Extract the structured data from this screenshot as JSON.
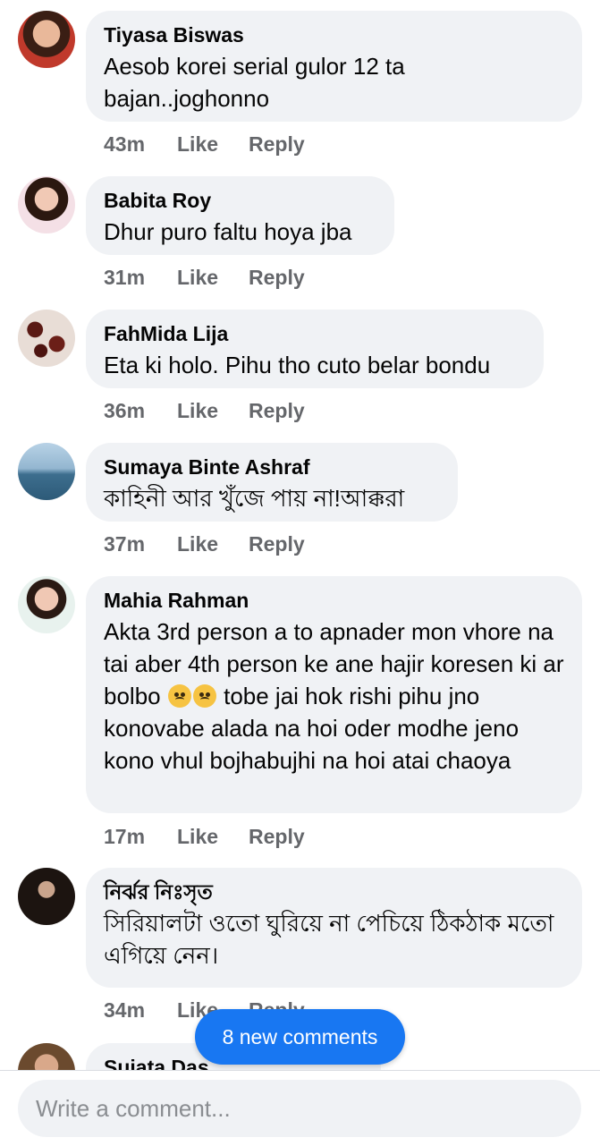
{
  "comments": [
    {
      "author": "Tiyasa Biswas",
      "text": "Aesob korei serial gulor 12 ta bajan..joghonno",
      "time": "43m",
      "like": "Like",
      "reply": "Reply"
    },
    {
      "author": "Babita Roy",
      "text": "Dhur puro faltu hoya jba",
      "time": "31m",
      "like": "Like",
      "reply": "Reply"
    },
    {
      "author": "FahMida Lija",
      "text": "Eta ki holo. Pihu tho cuto belar bondu",
      "time": "36m",
      "like": "Like",
      "reply": "Reply"
    },
    {
      "author": "Sumaya Binte Ashraf",
      "text": "কাহিনী আর খুঁজে পায় না!আক্করা",
      "time": "37m",
      "like": "Like",
      "reply": "Reply"
    },
    {
      "author": "Mahia Rahman",
      "text_before": "Akta 3rd person a to apnader mon vhore na tai aber 4th person ke ane hajir koresen ki ar bolbo",
      "text_after": "tobe jai hok rishi pihu jno konovabe alada na hoi oder modhe jeno kono vhul bojhabujhi na hoi atai chaoya",
      "time": "17m",
      "like": "Like",
      "reply": "Reply"
    },
    {
      "author": "নির্ঝর নিঃসৃত",
      "text": "সিরিয়ালটা ওতো ঘুরিয়ে না পেচিয়ে ঠিকঠাক মতো এগিয়ে নেন।",
      "time": "34m",
      "like": "Like",
      "reply": "Reply"
    },
    {
      "author": "Sujata Das"
    }
  ],
  "toast": {
    "label": "8 new comments"
  },
  "composer": {
    "placeholder": "Write a comment..."
  },
  "colors": {
    "bubble": "#f0f2f5",
    "meta": "#65676b",
    "accent": "#1877f2"
  },
  "icons": {
    "emoji": "angry-face-emoji"
  }
}
